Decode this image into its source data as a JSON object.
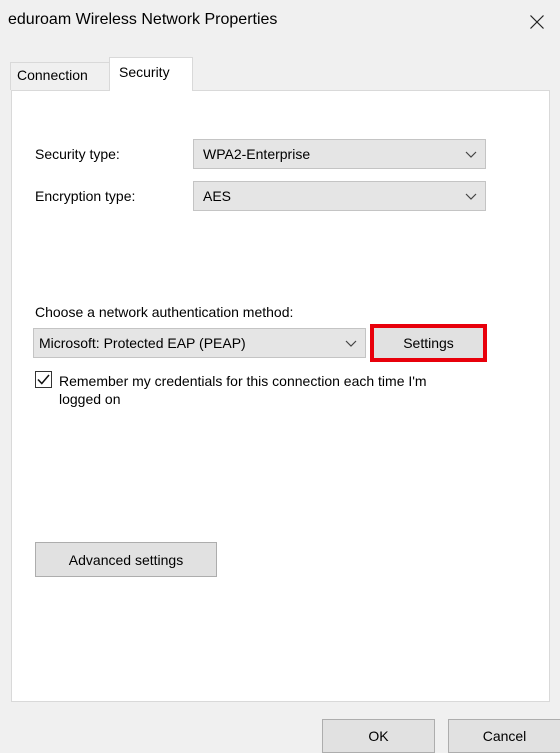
{
  "window": {
    "title": "eduroam Wireless Network Properties",
    "close_icon": "close-icon"
  },
  "tabs": [
    {
      "label": "Connection",
      "selected": false
    },
    {
      "label": "Security",
      "selected": true
    }
  ],
  "security": {
    "security_type_label": "Security type:",
    "security_type_value": "WPA2-Enterprise",
    "encryption_type_label": "Encryption type:",
    "encryption_type_value": "AES",
    "auth_method_label": "Choose a network authentication method:",
    "auth_method_value": "Microsoft: Protected EAP (PEAP)",
    "settings_button_label": "Settings",
    "remember_credentials_label": "Remember my credentials for this connection each time I'm logged on",
    "remember_credentials_checked": true,
    "advanced_settings_label": "Advanced settings"
  },
  "footer": {
    "ok_label": "OK",
    "cancel_label": "Cancel"
  },
  "colors": {
    "highlight_border": "#e8000b",
    "window_bg": "#f0f0f0",
    "panel_bg": "#ffffff"
  }
}
